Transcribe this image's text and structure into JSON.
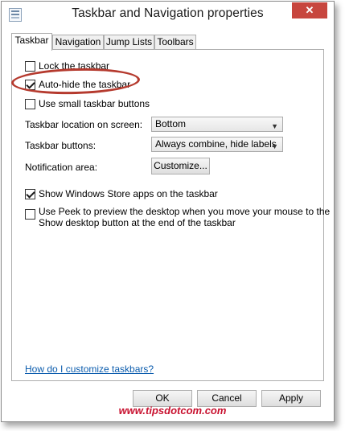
{
  "window": {
    "title": "Taskbar and Navigation properties",
    "close_glyph": "✕"
  },
  "tabs": [
    {
      "label": "Taskbar",
      "active": true
    },
    {
      "label": "Navigation",
      "active": false
    },
    {
      "label": "Jump Lists",
      "active": false
    },
    {
      "label": "Toolbars",
      "active": false
    }
  ],
  "checkboxes": {
    "lock": {
      "label": "Lock the taskbar",
      "checked": false
    },
    "autohide": {
      "label": "Auto-hide the taskbar",
      "checked": true
    },
    "small_buttons": {
      "label": "Use small taskbar buttons",
      "checked": false
    },
    "store_apps": {
      "label": "Show Windows Store apps on the taskbar",
      "checked": true
    },
    "peek_line1": {
      "label": "Use Peek to preview the desktop when you move your mouse to the",
      "checked": false
    },
    "peek_line2": "Show desktop button at the end of the taskbar"
  },
  "settings": {
    "location_label": "Taskbar location on screen:",
    "location_value": "Bottom",
    "buttons_label": "Taskbar buttons:",
    "buttons_value": "Always combine, hide labels",
    "notification_label": "Notification area:",
    "customize_button": "Customize..."
  },
  "help_link": "How do I customize taskbars?",
  "footer": {
    "ok": "OK",
    "cancel": "Cancel",
    "apply": "Apply"
  },
  "watermark": "www.tipsdotcom.com",
  "colors": {
    "close_button": "#c7463e",
    "highlight": "#b53a2e",
    "link": "#0b5cad",
    "watermark": "#c8102e"
  }
}
